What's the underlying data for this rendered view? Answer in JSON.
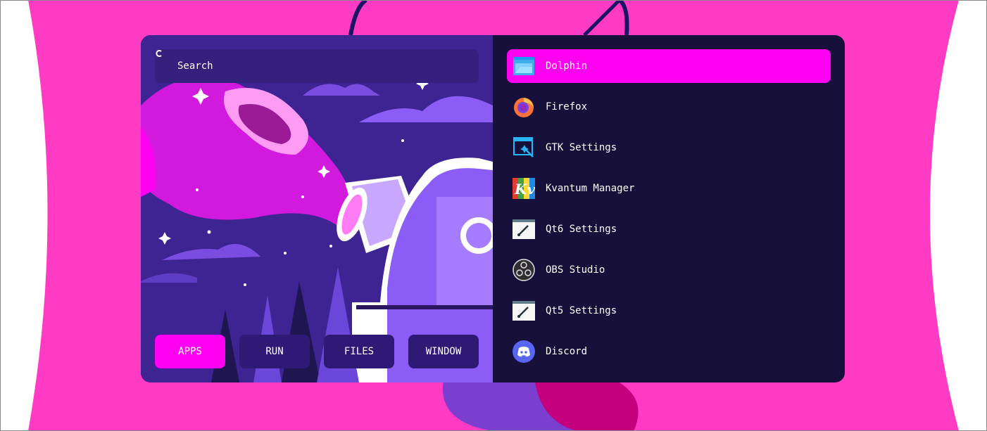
{
  "search": {
    "label": "Search"
  },
  "modes": [
    {
      "label": "APPS",
      "active": true
    },
    {
      "label": "RUN",
      "active": false
    },
    {
      "label": "FILES",
      "active": false
    },
    {
      "label": "WINDOW",
      "active": false
    }
  ],
  "apps": [
    {
      "label": "Dolphin",
      "icon": "dolphin-icon",
      "selected": true
    },
    {
      "label": "Firefox",
      "icon": "firefox-icon"
    },
    {
      "label": "GTK Settings",
      "icon": "gtk-settings-icon"
    },
    {
      "label": "Kvantum Manager",
      "icon": "kvantum-icon"
    },
    {
      "label": "Qt6 Settings",
      "icon": "qt6-settings-icon"
    },
    {
      "label": "OBS Studio",
      "icon": "obs-icon"
    },
    {
      "label": "Qt5 Settings",
      "icon": "qt5-settings-icon"
    },
    {
      "label": "Discord",
      "icon": "discord-icon"
    }
  ],
  "colors": {
    "desktop": "#ff3bc4",
    "panel": "#16103a",
    "accent": "#ff00f0",
    "art_bg": "#3e2392",
    "button": "#2e1a74"
  }
}
